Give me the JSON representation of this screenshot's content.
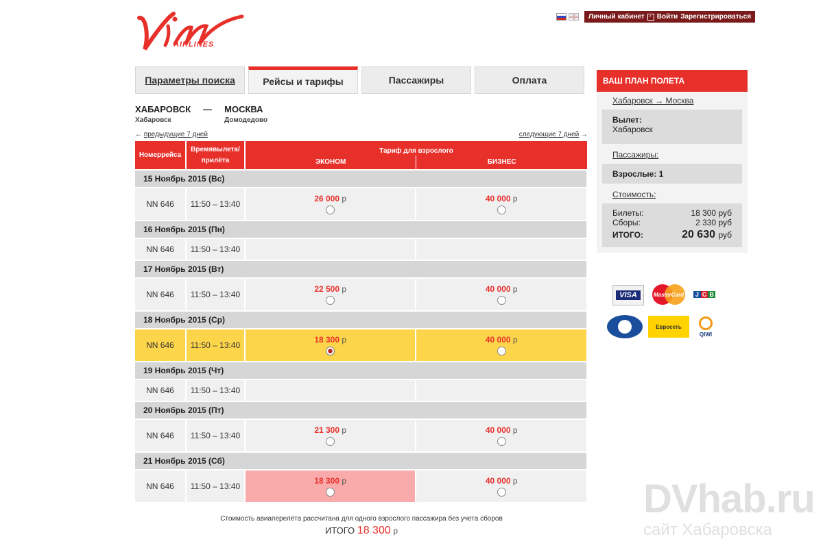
{
  "header": {
    "logo_alt": "Vim Airlines",
    "account": "Личный кабинет",
    "login": "Войти",
    "register": "Зарегистрироваться"
  },
  "tabs": [
    {
      "label": "Параметры поиска"
    },
    {
      "label": "Рейсы и тарифы"
    },
    {
      "label": "Пассажиры"
    },
    {
      "label": "Оплата"
    }
  ],
  "route": {
    "from": "ХАБАРОВСК",
    "from_sub": "Хабаровск",
    "dash": "—",
    "to": "МОСКВА",
    "to_sub": "Домодедово"
  },
  "nav": {
    "prev": "предыдущие 7 дней",
    "next": "следующие 7 дней"
  },
  "table": {
    "col_flight": "Номеррейса",
    "col_time": "Времявылета/прилёта",
    "col_tariff": "Тариф для взрослого",
    "col_econom": "ЭКОНОМ",
    "col_business": "БИЗНЕС",
    "currency": "р",
    "days": [
      {
        "date": "15 Ноябрь 2015 (Вс)",
        "flight": "NN 646",
        "time": "11:50 – 13:40",
        "econom": "26 000",
        "business": "40 000"
      },
      {
        "date": "16 Ноябрь 2015 (Пн)",
        "flight": "NN 646",
        "time": "11:50 – 13:40",
        "econom": "",
        "business": ""
      },
      {
        "date": "17 Ноябрь 2015 (Вт)",
        "flight": "NN 646",
        "time": "11:50 – 13:40",
        "econom": "22 500",
        "business": "40 000"
      },
      {
        "date": "18 Ноябрь 2015 (Ср)",
        "flight": "NN 646",
        "time": "11:50 – 13:40",
        "econom": "18 300",
        "business": "40 000"
      },
      {
        "date": "19 Ноябрь 2015 (Чт)",
        "flight": "NN 646",
        "time": "11:50 – 13:40",
        "econom": "",
        "business": ""
      },
      {
        "date": "20 Ноябрь 2015 (Пт)",
        "flight": "NN 646",
        "time": "11:50 – 13:40",
        "econom": "21 300",
        "business": "40 000"
      },
      {
        "date": "21 Ноябрь 2015 (Сб)",
        "flight": "NN 646",
        "time": "11:50 – 13:40",
        "econom": "18 300",
        "business": "40 000"
      }
    ]
  },
  "footer": {
    "note": "Стоимость авиаперелёта рассчитана для одного взрослого пассажира без учета сборов",
    "total_label": "ИТОГО",
    "total_value": "18 300",
    "total_currency": "р"
  },
  "plan": {
    "title": "ВАШ ПЛАН ПОЛЕТА",
    "route": "Хабаровск → Москва",
    "departure_label": "Вылет:",
    "departure_value": "Хабаровск",
    "passengers_link": "Пассажиры:",
    "adults": "Взрослые: 1",
    "cost_link": "Стоимость:",
    "tickets_label": "Билеты:",
    "tickets_value": "18 300 руб",
    "fees_label": "Сборы:",
    "fees_value": "2 330 руб",
    "total_label": "ИТОГО:",
    "total_value": "20 630",
    "total_currency": "руб"
  },
  "payments": {
    "visa": "VISA",
    "mastercard": "MasterCard",
    "jcb": [
      "J",
      "C",
      "B"
    ],
    "euroset": "Евросеть",
    "qiwi": "QIWI"
  },
  "watermark": {
    "big": "DVhab.ru",
    "small": "сайт Хабаровска"
  },
  "colors": {
    "accent": "#e8302b",
    "selected_row": "#fdd54a",
    "pink_cell": "#f9aaaa",
    "account_bar": "#7a1a1a"
  }
}
